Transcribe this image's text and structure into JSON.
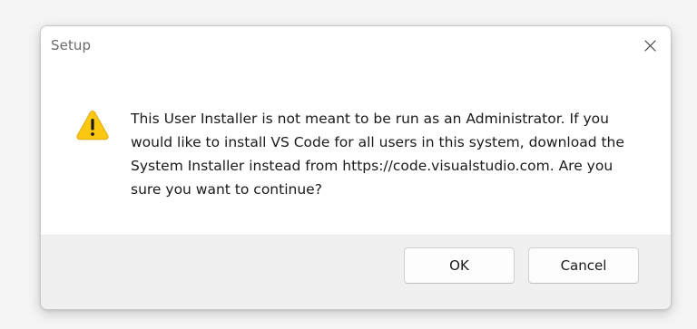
{
  "dialog": {
    "title": "Setup",
    "close_icon": "close-icon",
    "warning_icon": "warning-icon",
    "message": "This User Installer is not meant to be run as an Administrator. If you would like to install VS Code for all users in this system, download the System Installer instead from https://code.visualstudio.com. Are you sure you want to continue?",
    "buttons": {
      "ok_label": "OK",
      "cancel_label": "Cancel"
    }
  },
  "colors": {
    "warning_fill": "#fcc80f",
    "warning_glyph": "#1a1a1a",
    "footer_bg": "#f0f0f0",
    "content_bg": "#ffffff"
  }
}
